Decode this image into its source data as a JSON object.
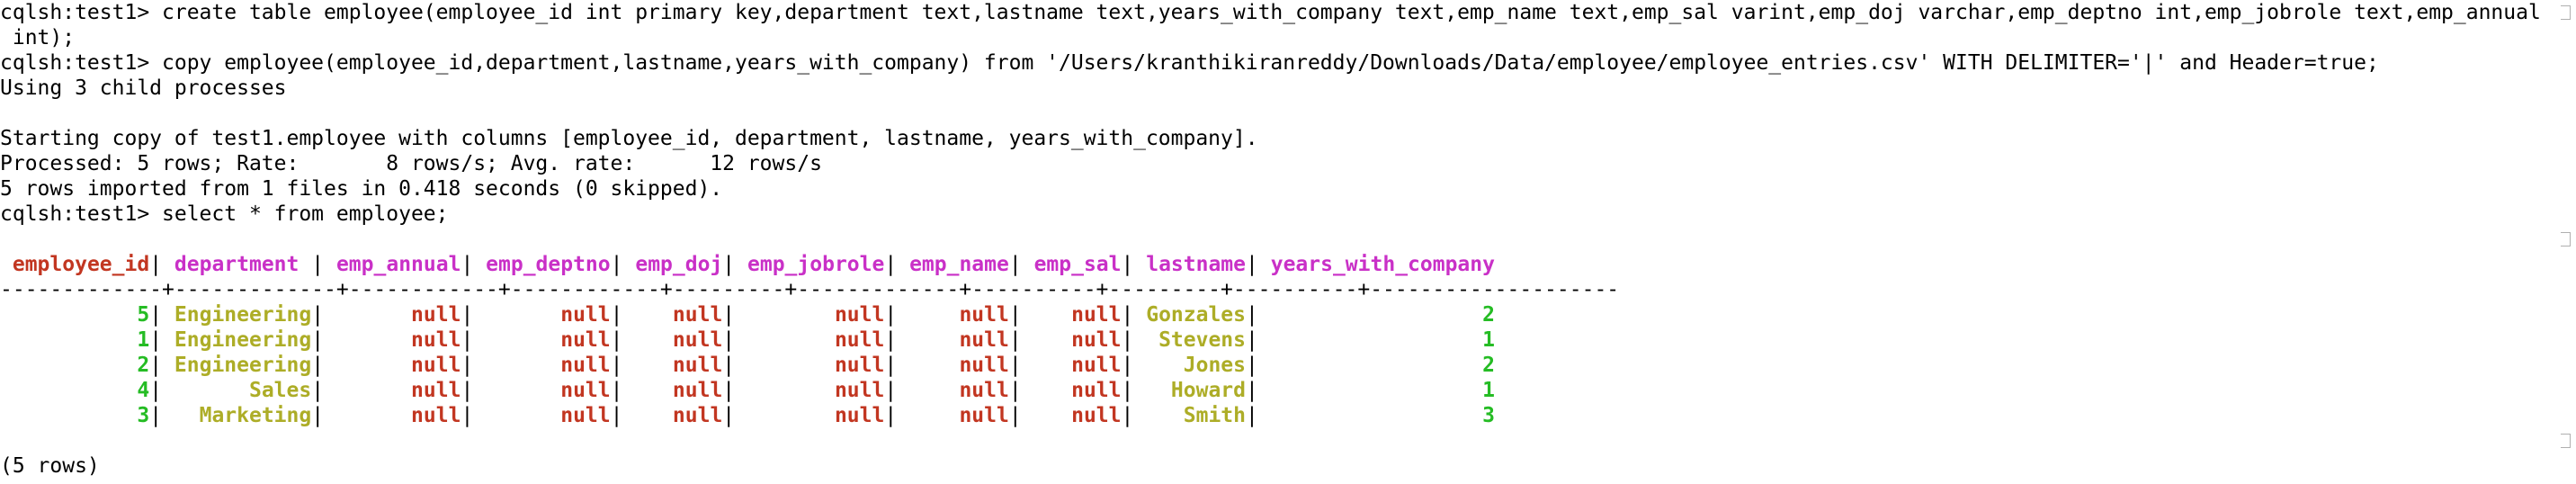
{
  "window": {
    "type": "terminal",
    "app": "cqlsh"
  },
  "colors": {
    "background": "#ffffff",
    "text": "#000000",
    "header_key": "#c23621",
    "header_col": "#c930c7",
    "int_value": "#25bc24",
    "text_value": "#adad27",
    "null_value": "#c23621"
  },
  "lines": {
    "l1": "cqlsh:test1> create table employee(employee_id int primary key,department text,lastname text,years_with_company text,emp_name text,emp_sal varint,emp_doj varchar,emp_deptno int,emp_jobrole text,emp_annual",
    "l2": " int);",
    "l3": "cqlsh:test1> copy employee(employee_id,department,lastname,years_with_company) from '/Users/kranthikiranreddy/Downloads/Data/employee/employee_entries.csv' WITH DELIMITER='|' and Header=true;",
    "l4": "Using 3 child processes",
    "l5": "",
    "l6": "Starting copy of test1.employee with columns [employee_id, department, lastname, years_with_company].",
    "l7": "Processed: 5 rows; Rate:       8 rows/s; Avg. rate:      12 rows/s",
    "l8": "5 rows imported from 1 files in 0.418 seconds (0 skipped).",
    "l9": "cqlsh:test1> select * from employee;",
    "rows_count": "(5 rows)"
  },
  "table": {
    "columns": [
      "employee_id",
      "department",
      "emp_annual",
      "emp_deptno",
      "emp_doj",
      "emp_jobrole",
      "emp_name",
      "emp_sal",
      "lastname",
      "years_with_company"
    ],
    "separator": "-------------+-------------+------------+------------+---------+-------------+----------+---------+----------+--------------------",
    "rows": [
      {
        "employee_id": "5",
        "department": "Engineering",
        "emp_annual": "null",
        "emp_deptno": "null",
        "emp_doj": "null",
        "emp_jobrole": "null",
        "emp_name": "null",
        "emp_sal": "null",
        "lastname": "Gonzales",
        "years_with_company": "2"
      },
      {
        "employee_id": "1",
        "department": "Engineering",
        "emp_annual": "null",
        "emp_deptno": "null",
        "emp_doj": "null",
        "emp_jobrole": "null",
        "emp_name": "null",
        "emp_sal": "null",
        "lastname": "Stevens",
        "years_with_company": "1"
      },
      {
        "employee_id": "2",
        "department": "Engineering",
        "emp_annual": "null",
        "emp_deptno": "null",
        "emp_doj": "null",
        "emp_jobrole": "null",
        "emp_name": "null",
        "emp_sal": "null",
        "lastname": "Jones",
        "years_with_company": "2"
      },
      {
        "employee_id": "4",
        "department": "Sales",
        "emp_annual": "null",
        "emp_deptno": "null",
        "emp_doj": "null",
        "emp_jobrole": "null",
        "emp_name": "null",
        "emp_sal": "null",
        "lastname": "Howard",
        "years_with_company": "1"
      },
      {
        "employee_id": "3",
        "department": "Marketing",
        "emp_annual": "null",
        "emp_deptno": "null",
        "emp_doj": "null",
        "emp_jobrole": "null",
        "emp_name": "null",
        "emp_sal": "null",
        "lastname": "Smith",
        "years_with_company": "3"
      }
    ]
  }
}
